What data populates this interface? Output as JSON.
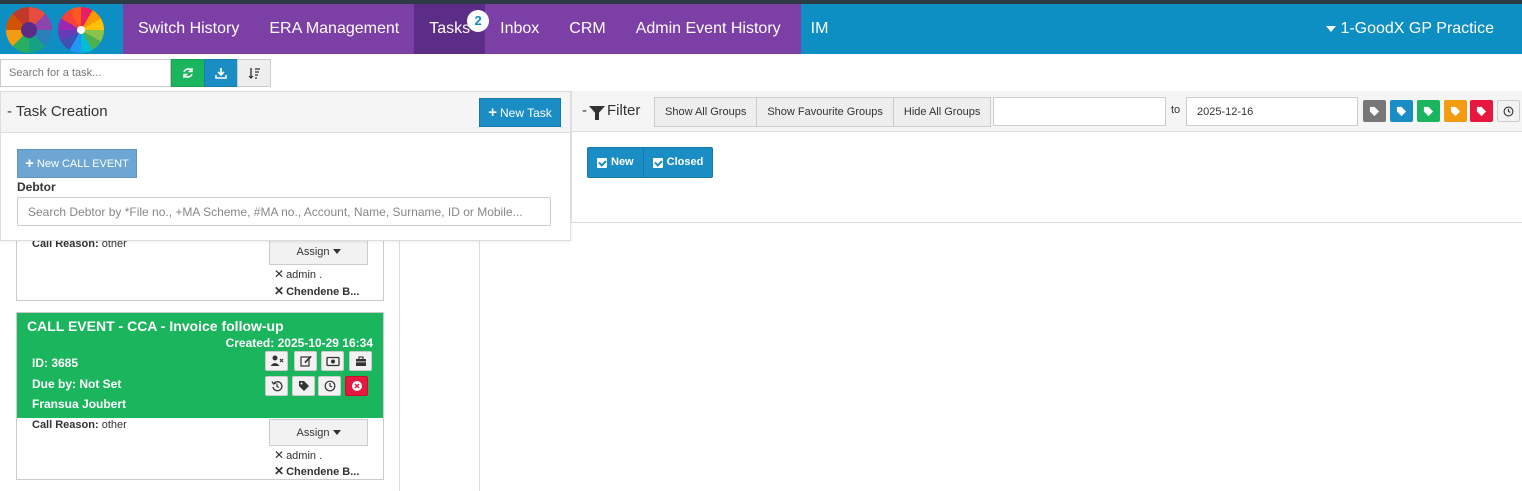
{
  "nav": {
    "items": [
      {
        "label": "Switch History"
      },
      {
        "label": "ERA Management"
      },
      {
        "label": "Tasks",
        "badge": "2"
      },
      {
        "label": "Inbox"
      },
      {
        "label": "CRM"
      },
      {
        "label": "Admin Event History"
      },
      {
        "label": "IM"
      }
    ],
    "practice": "1-GoodX GP Practice"
  },
  "toolbar": {
    "search_placeholder": "Search for a task...",
    "refresh_icon": "refresh-icon",
    "download_icon": "download-icon",
    "sort_icon": "sort-icon"
  },
  "task_creation": {
    "title": "- Task Creation",
    "new_task_label": "New Task",
    "new_call_event_label": "New CALL EVENT",
    "debtor_label": "Debtor",
    "debtor_placeholder": "Search Debtor by *File no., +MA Scheme, #MA no., Account, Name, Surname, ID or Mobile..."
  },
  "filter": {
    "title": "Filter",
    "group_buttons": [
      "Show All Groups",
      "Show Favourite Groups",
      "Hide All Groups"
    ],
    "date_from": "",
    "to_label": "to",
    "date_to": "2025-12-16",
    "tag_colors": [
      "#777777",
      "#1a8dc4",
      "#1ab55c",
      "#f39c12",
      "#e8173f",
      "#f2f2f2"
    ],
    "status_new": "New",
    "status_closed": "Closed"
  },
  "tasks": [
    {
      "call_reason_label": "Call Reason:",
      "call_reason": "other",
      "assign_label": "Assign",
      "assignees": [
        "admin .",
        "Chendene B..."
      ]
    },
    {
      "title": "CALL EVENT - CCA - Invoice follow-up",
      "created": "Created:  2025-10-29 16:34",
      "id": "ID: 3685",
      "due": "Due by:  Not Set",
      "owner": "Fransua Joubert",
      "call_reason_label": "Call Reason:",
      "call_reason": "other",
      "assign_label": "Assign",
      "assignees": [
        "admin .",
        "Chendene B..."
      ],
      "color": "#1ab55c"
    }
  ],
  "colors": {
    "brand_blue": "#0d8fc4",
    "nav_purple": "#7b3fa6",
    "success_green": "#1ab55c",
    "danger_red": "#e8173f"
  }
}
